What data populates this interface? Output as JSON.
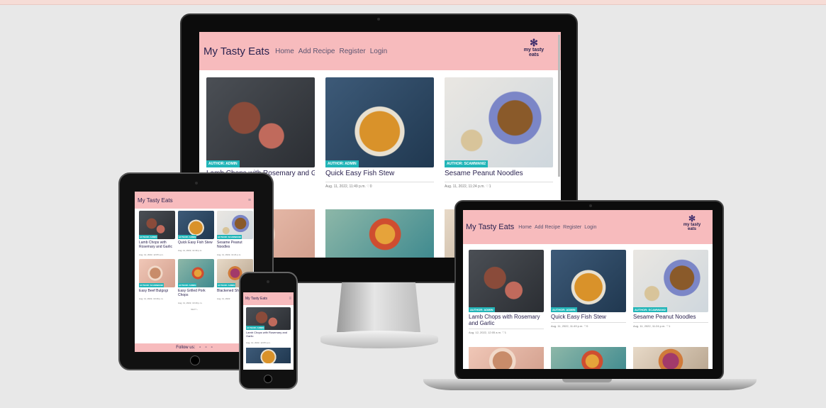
{
  "site": {
    "brand": "My Tasty Eats",
    "nav": [
      "Home",
      "Add Recipe",
      "Register",
      "Login"
    ],
    "logo_line1": "my tasty",
    "logo_line2": "eats",
    "menu_icon": "hamburger-icon",
    "logo_icon": "whisk-logo-icon"
  },
  "colors": {
    "nav_bg": "#f7bbbd",
    "brand_text": "#2b2350",
    "badge_bg": "#22b5b8"
  },
  "recipes": [
    {
      "title": "Lamb Chops with Rosemary and Garlic",
      "author": "AUTHOR: ADMIN",
      "date": "Aug. 12, 2022, 12:05 a.m.",
      "likes": "1"
    },
    {
      "title": "Quick Easy Fish Stew",
      "author": "AUTHOR: ADMIN",
      "date": "Aug. 11, 2022, 11:49 p.m.",
      "likes": "0"
    },
    {
      "title": "Sesame Peanut Noodles",
      "author": "AUTHOR: SCAMWANI2",
      "date": "Aug. 11, 2022, 11:24 p.m.",
      "likes": "1"
    },
    {
      "title": "Easy Beef Bulgogi",
      "author": "AUTHOR: SCAMWANI2",
      "date": "Aug. 11, 2022, 10:49 p.m.",
      "likes": "1"
    },
    {
      "title": "Easy Grilled Pork Chops",
      "author": "AUTHOR: ADMIN",
      "date": "Aug. 11, 2022, 10:49 p.m.",
      "likes": "1"
    },
    {
      "title": "Blackened Shrimp Tac",
      "author": "AUTHOR: ADMIN",
      "date": "Aug. 11, 2022",
      "likes": "1"
    }
  ],
  "pagination": {
    "next_label": "NEXT ›"
  },
  "footer": {
    "follow_label": "Follow us:"
  }
}
